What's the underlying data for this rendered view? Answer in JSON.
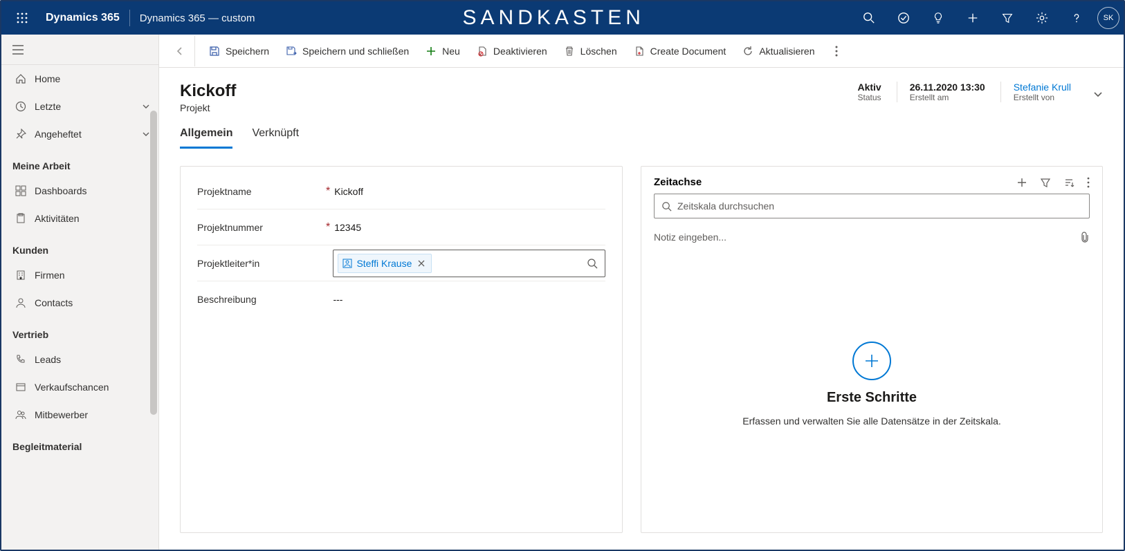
{
  "topbar": {
    "brand": "Dynamics 365",
    "app_name": "Dynamics 365 — custom",
    "env": "SANDKASTEN",
    "avatar_initials": "SK"
  },
  "sidebar": {
    "home": "Home",
    "recent": "Letzte",
    "pinned": "Angeheftet",
    "groups": {
      "work": "Meine Arbeit",
      "customers": "Kunden",
      "sales": "Vertrieb",
      "collateral": "Begleitmaterial"
    },
    "items": {
      "dashboards": "Dashboards",
      "activities": "Aktivitäten",
      "accounts": "Firmen",
      "contacts": "Contacts",
      "leads": "Leads",
      "opportunities": "Verkaufschancen",
      "competitors": "Mitbewerber"
    }
  },
  "cmdbar": {
    "save": "Speichern",
    "save_close": "Speichern und schließen",
    "new": "Neu",
    "deactivate": "Deaktivieren",
    "delete": "Löschen",
    "create_doc": "Create Document",
    "refresh": "Aktualisieren"
  },
  "record": {
    "title": "Kickoff",
    "subtitle": "Projekt",
    "status_value": "Aktiv",
    "status_label": "Status",
    "created_value": "26.11.2020 13:30",
    "created_label": "Erstellt am",
    "creator_value": "Stefanie Krull",
    "creator_label": "Erstellt von"
  },
  "tabs": {
    "general": "Allgemein",
    "related": "Verknüpft"
  },
  "form": {
    "projectname_label": "Projektname",
    "projectname_value": "Kickoff",
    "projectnumber_label": "Projektnummer",
    "projectnumber_value": "12345",
    "projectlead_label": "Projektleiter*in",
    "projectlead_value": "Steffi Krause",
    "description_label": "Beschreibung",
    "description_value": "---"
  },
  "timeline": {
    "title": "Zeitachse",
    "search_placeholder": "Zeitskala durchsuchen",
    "note_placeholder": "Notiz eingeben...",
    "empty_title": "Erste Schritte",
    "empty_text": "Erfassen und verwalten Sie alle Datensätze in der Zeitskala."
  }
}
